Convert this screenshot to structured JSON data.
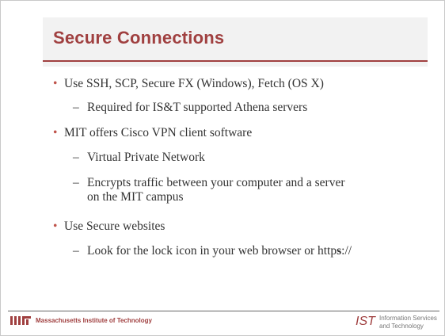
{
  "slide": {
    "title": "Secure Connections",
    "bullets": [
      {
        "text": "Use SSH, SCP, Secure FX (Windows), Fetch (OS X)",
        "subs": [
          "Required for IS&T supported Athena servers"
        ]
      },
      {
        "text": "MIT offers Cisco VPN client software",
        "subs": [
          "Virtual Private Network",
          "Encrypts traffic between your computer and a server on the MIT campus"
        ]
      },
      {
        "text": "Use Secure websites",
        "subs": [
          "Look for the lock icon in your web browser or https://"
        ]
      }
    ],
    "https": {
      "pre": "http",
      "bold": "s",
      "post": "://"
    }
  },
  "footer": {
    "mit_name": "Massachusetts Institute of Technology",
    "ist_logo": "IST",
    "ist_line1": "Information Services",
    "ist_line2": "and Technology"
  },
  "colors": {
    "accent": "#a04040",
    "bullet": "#c0554c"
  }
}
